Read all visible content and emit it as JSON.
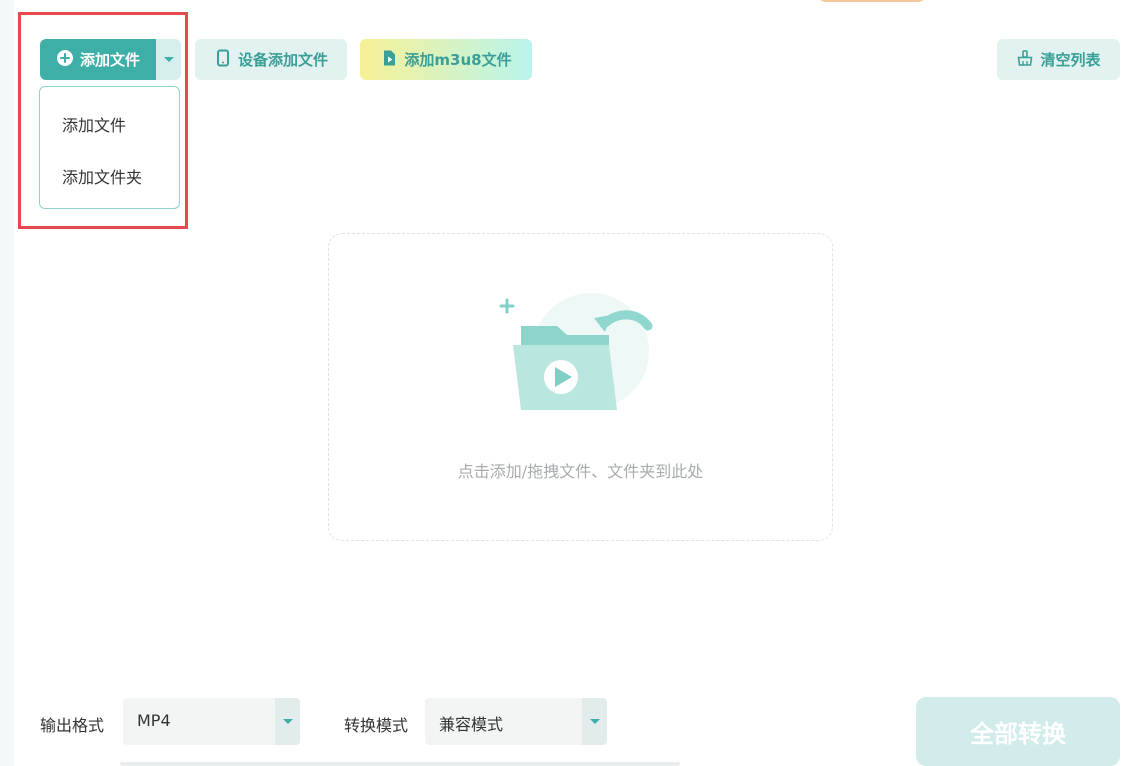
{
  "toolbar": {
    "add_file_label": "添加文件",
    "device_add_label": "设备添加文件",
    "m3u8_add_label": "添加m3u8文件",
    "clear_list_label": "清空列表"
  },
  "add_menu": {
    "items": [
      {
        "label": "添加文件"
      },
      {
        "label": "添加文件夹"
      }
    ]
  },
  "drop_zone": {
    "hint": "点击添加/拖拽文件、文件夹到此处"
  },
  "bottom": {
    "output_format_label": "输出格式",
    "output_format_value": "MP4",
    "convert_mode_label": "转换模式",
    "convert_mode_value": "兼容模式",
    "convert_all_label": "全部转换"
  },
  "colors": {
    "accent": "#3dafa6",
    "highlight": "#e64a4f"
  },
  "icons": {
    "add_file": "plus-circle-icon",
    "device": "tablet-icon",
    "m3u8": "play-file-icon",
    "clear": "broom-icon",
    "dropdown_caret": "caret-down-icon",
    "illustration": "folder-video-icon"
  }
}
